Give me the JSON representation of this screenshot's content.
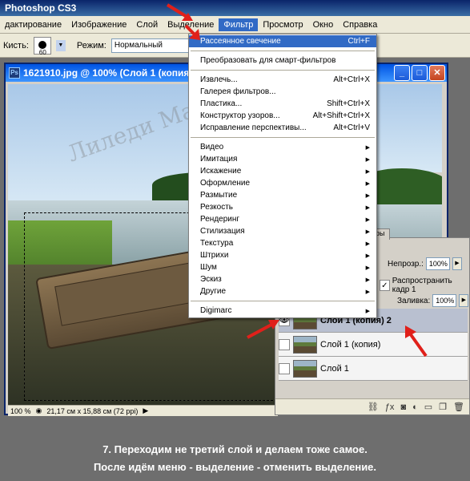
{
  "app": {
    "title": "Photoshop CS3"
  },
  "menubar": {
    "items": [
      {
        "label": "дактирование"
      },
      {
        "label": "Изображение"
      },
      {
        "label": "Слой"
      },
      {
        "label": "Выделение"
      },
      {
        "label": "Фильтр"
      },
      {
        "label": "Просмотр"
      },
      {
        "label": "Окно"
      },
      {
        "label": "Справка"
      }
    ],
    "active_index": 4
  },
  "options": {
    "brush_label": "Кисть:",
    "brush_size": "60",
    "mode_label": "Режим:",
    "mode_value": "Нормальный"
  },
  "document": {
    "title": "1621910.jpg @ 100% (Слой 1 (копия",
    "zoom": "100 %",
    "doc_info": "21,17 см x 15,88 см (72 ppi)",
    "watermark": "Лиледи Мал"
  },
  "filter_menu": {
    "groups": [
      [
        {
          "label": "Рассеянное свечение",
          "shortcut": "Ctrl+F",
          "highlight": true
        }
      ],
      [
        {
          "label": "Преобразовать для смарт-фильтров",
          "shortcut": ""
        }
      ],
      [
        {
          "label": "Извлечь...",
          "shortcut": "Alt+Ctrl+X"
        },
        {
          "label": "Галерея фильтров...",
          "shortcut": ""
        },
        {
          "label": "Пластика...",
          "shortcut": "Shift+Ctrl+X"
        },
        {
          "label": "Конструктор узоров...",
          "shortcut": "Alt+Shift+Ctrl+X"
        },
        {
          "label": "Исправление перспективы...",
          "shortcut": "Alt+Ctrl+V"
        }
      ],
      [
        {
          "label": "Видео",
          "submenu": true
        },
        {
          "label": "Имитация",
          "submenu": true
        },
        {
          "label": "Искажение",
          "submenu": true
        },
        {
          "label": "Оформление",
          "submenu": true
        },
        {
          "label": "Размытие",
          "submenu": true
        },
        {
          "label": "Резкость",
          "submenu": true
        },
        {
          "label": "Рендеринг",
          "submenu": true
        },
        {
          "label": "Стилизация",
          "submenu": true
        },
        {
          "label": "Текстура",
          "submenu": true
        },
        {
          "label": "Штрихи",
          "submenu": true
        },
        {
          "label": "Шум",
          "submenu": true
        },
        {
          "label": "Эскиз",
          "submenu": true
        },
        {
          "label": "Другие",
          "submenu": true
        }
      ],
      [
        {
          "label": "Digimarc",
          "submenu": true
        }
      ]
    ]
  },
  "layers_panel": {
    "tab_label": "ры",
    "opacity_label": "Непрозр.:",
    "opacity_value": "100%",
    "propagate_label": "Распространить кадр 1",
    "fill_label": "Заливка:",
    "fill_value": "100%",
    "layers": [
      {
        "name": "Слой 1 (копия) 2",
        "selected": true,
        "visible": true
      },
      {
        "name": "Слой 1 (копия)",
        "selected": false,
        "visible": false
      },
      {
        "name": "Слой 1",
        "selected": false,
        "visible": false
      }
    ]
  },
  "caption": {
    "line1": "7. Переходим не третий слой и делаем тоже самое.",
    "line2": "После идём меню - выделение - отменить выделение."
  },
  "colors": {
    "accent": "#316ac5",
    "arrow": "#e0201a"
  }
}
